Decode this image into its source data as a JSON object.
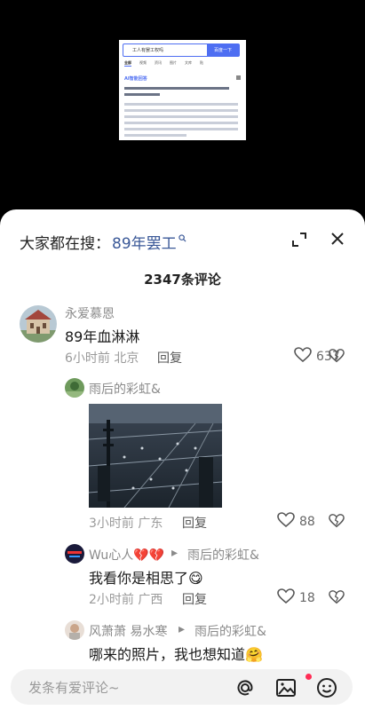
{
  "video": {
    "search_query": "工人有罢工权吗",
    "search_button": "百度一下",
    "tabs": [
      "全部",
      "视频",
      "资讯",
      "图片",
      "文库",
      "贴"
    ],
    "ai_title": "AI智能回答"
  },
  "header": {
    "prefix": "大家都在搜：",
    "keyword": "89年罢工"
  },
  "comments_count": "2347条评论",
  "comments": [
    {
      "user": "永爱慕恩",
      "text": "89年血淋淋",
      "time_location": "6小时前 北京",
      "reply_label": "回复",
      "likes": "637"
    },
    {
      "user": "雨后的彩虹&",
      "time_location": "3小时前 广东",
      "reply_label": "回复",
      "likes": "88"
    },
    {
      "user": "Wu心人💔💔",
      "reply_to": "雨后的彩虹&",
      "text": "我看你是相思了😋",
      "time_location": "2小时前 广西",
      "reply_label": "回复",
      "likes": "18"
    },
    {
      "user": "风萧萧 易水寒",
      "reply_to": "雨后的彩虹&",
      "text": "哪来的照片，我也想知道🤗"
    }
  ],
  "input": {
    "placeholder": "发条有爱评论~"
  },
  "colors": {
    "accent": "#3b5998",
    "notification_dot": "#ff2c55"
  }
}
